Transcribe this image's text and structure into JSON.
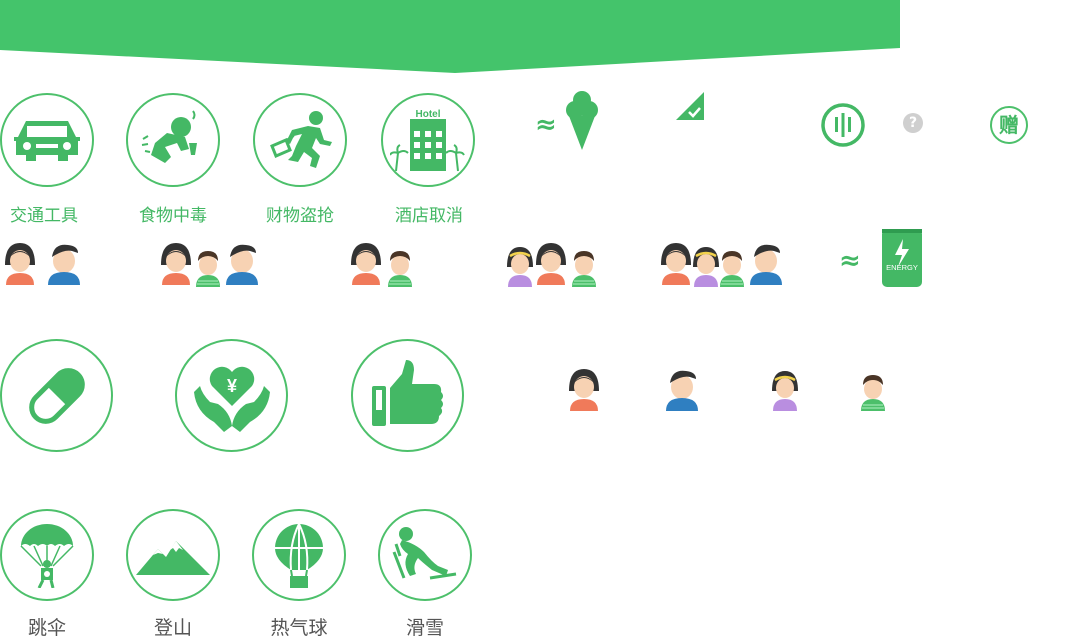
{
  "colors": {
    "brand_green": "#44b865",
    "gray_label": "#555555"
  },
  "row1_icons": [
    {
      "icon": "car-icon",
      "label": "交通工具"
    },
    {
      "icon": "food-poisoning-icon",
      "label": "食物中毒"
    },
    {
      "icon": "theft-icon",
      "label": "财物盗抢"
    },
    {
      "icon": "hotel-icon",
      "label": "酒店取消",
      "sign": "Hotel"
    }
  ],
  "misc": {
    "approx_symbol": "≈",
    "question_mark": "?",
    "gift_badge": "赠",
    "energy_text": "ENERGY"
  },
  "row3_icons": [
    {
      "icon": "pill-icon"
    },
    {
      "icon": "heart-hands-icon",
      "symbol": "¥"
    },
    {
      "icon": "thumbs-up-icon"
    }
  ],
  "row4_icons": [
    {
      "icon": "skydiving-icon",
      "label": "跳伞"
    },
    {
      "icon": "mountain-icon",
      "label": "登山"
    },
    {
      "icon": "hot-air-balloon-icon",
      "label": "热气球"
    },
    {
      "icon": "skiing-icon",
      "label": "滑雪"
    }
  ]
}
